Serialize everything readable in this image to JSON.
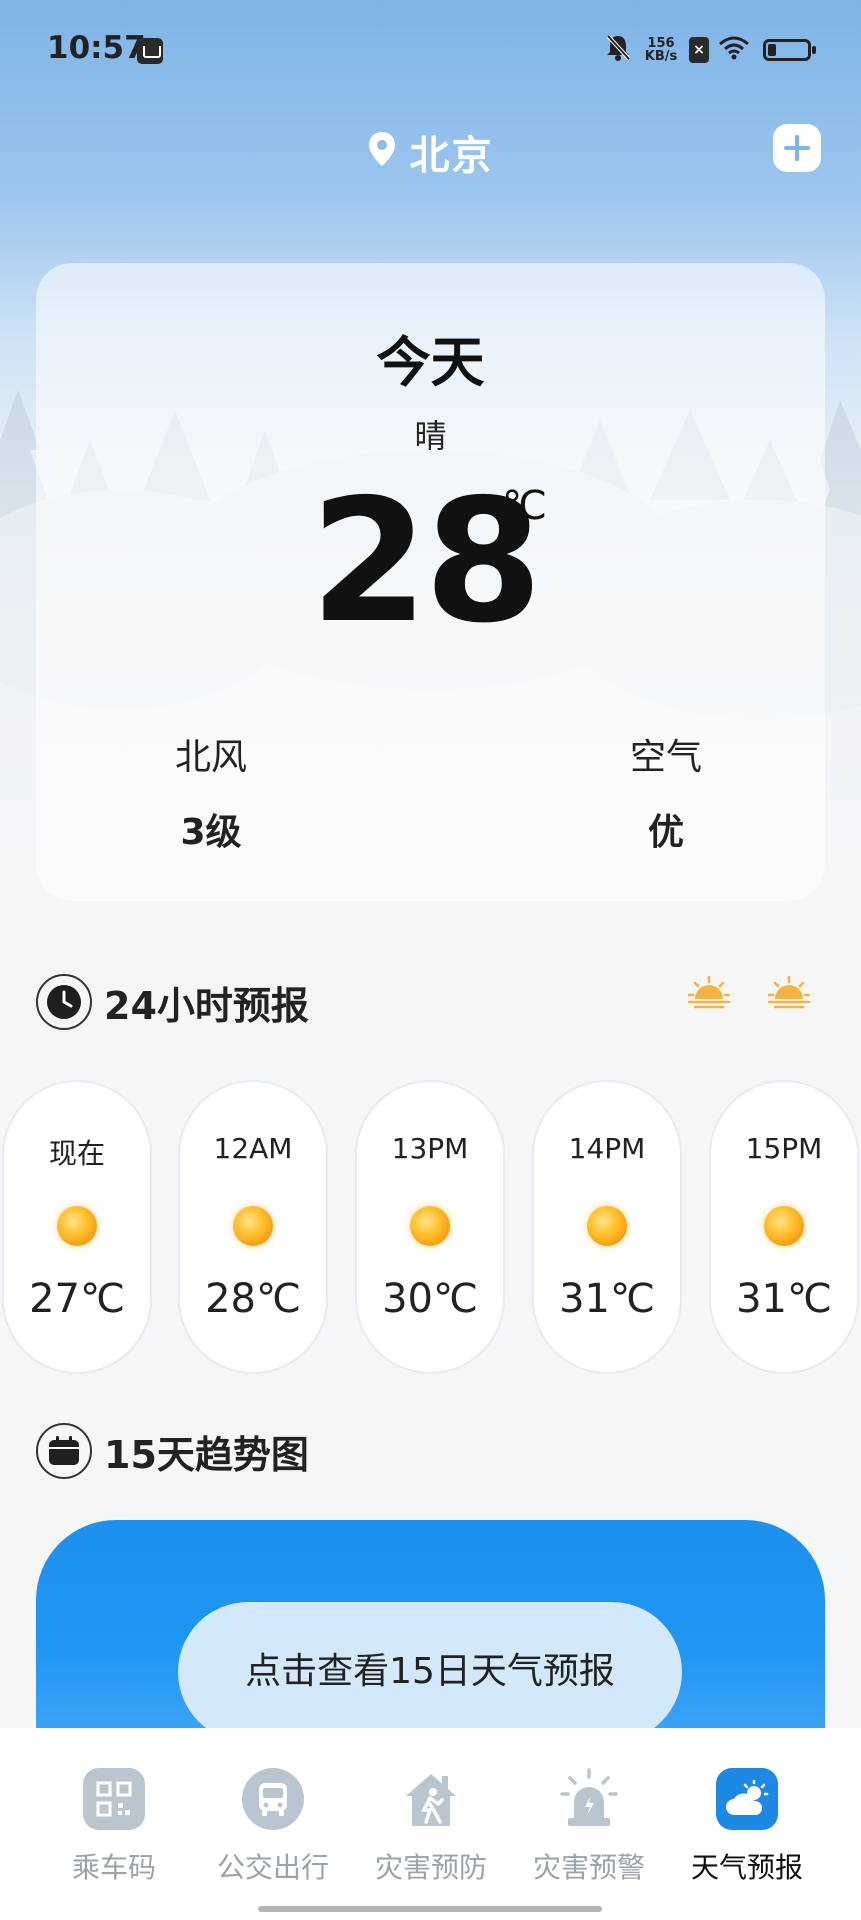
{
  "status_bar": {
    "time": "10:57",
    "net_speed_value": "156",
    "net_speed_unit": "KB/s",
    "icons": [
      "sim-icon",
      "bell-off-icon",
      "x-icon",
      "wifi-icon",
      "battery-icon"
    ]
  },
  "header": {
    "city": "北京",
    "add_icon": "plus-icon"
  },
  "today": {
    "title": "今天",
    "condition": "晴",
    "temperature": "28",
    "unit": "℃",
    "wind_direction": "北风",
    "wind_level": "3级",
    "air_label": "空气",
    "air_quality": "优"
  },
  "hourly": {
    "title": "24小时预报",
    "items": [
      {
        "time": "现在",
        "temp": "27℃",
        "icon": "sun-icon"
      },
      {
        "time": "12AM",
        "temp": "28℃",
        "icon": "sun-icon"
      },
      {
        "time": "13PM",
        "temp": "30℃",
        "icon": "sun-icon"
      },
      {
        "time": "14PM",
        "temp": "31℃",
        "icon": "sun-icon"
      },
      {
        "time": "15PM",
        "temp": "31℃",
        "icon": "sun-icon"
      }
    ]
  },
  "trend": {
    "title": "15天趋势图",
    "button": "点击查看15日天气预报"
  },
  "nav": {
    "items": [
      {
        "label": "乘车码",
        "icon": "qr-code-icon",
        "active": false
      },
      {
        "label": "公交出行",
        "icon": "bus-icon",
        "active": false
      },
      {
        "label": "灾害预防",
        "icon": "house-runner-icon",
        "active": false
      },
      {
        "label": "灾害预警",
        "icon": "alarm-light-icon",
        "active": false
      },
      {
        "label": "天气预报",
        "icon": "weather-icon",
        "active": true
      }
    ]
  },
  "colors": {
    "accent": "#1e88e5",
    "sun": "#f5a623",
    "inactive": "#9aa3aa"
  }
}
